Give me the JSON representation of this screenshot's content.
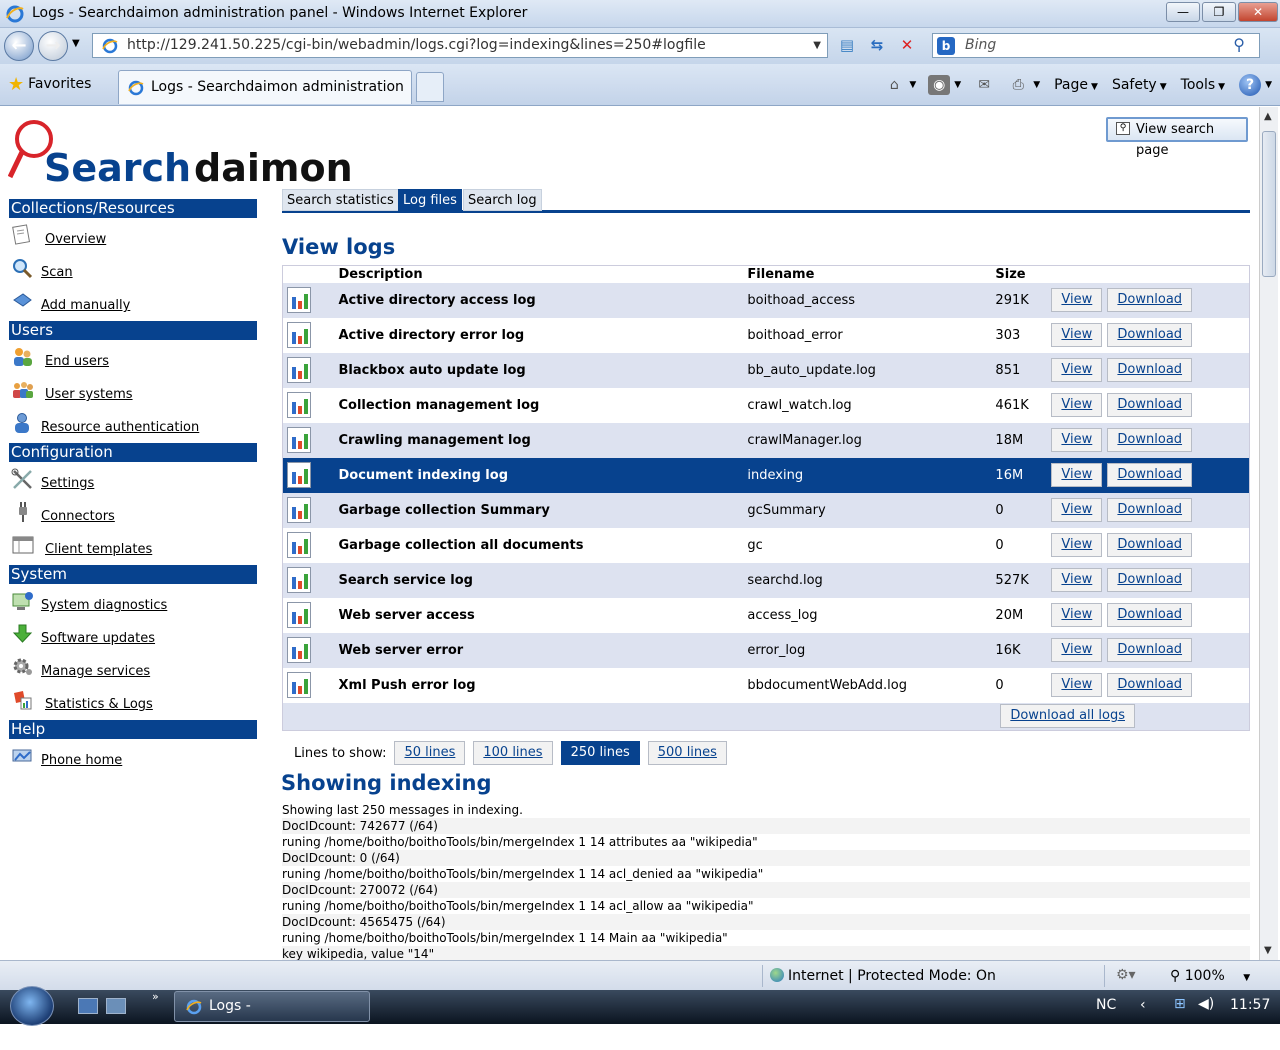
{
  "window": {
    "title": "Logs - Searchdaimon administration panel - Windows Internet Explorer",
    "min_glyph": "—",
    "max_glyph": "❐",
    "close_glyph": "✕"
  },
  "navbar": {
    "url": "http://129.241.50.225/cgi-bin/webadmin/logs.cgi?log=indexing&lines=250#logfile",
    "search_placeholder": "Bing",
    "back_glyph": "←",
    "forward_glyph": "→"
  },
  "tabbar": {
    "favorites_label": "Favorites",
    "tab_title": "Logs - Searchdaimon administration ...",
    "page_label": "Page",
    "safety_label": "Safety",
    "tools_label": "Tools"
  },
  "page": {
    "view_search_label": "View search page",
    "tabs": [
      "Search statistics",
      "Log files",
      "Search log"
    ],
    "active_tab": "Log files",
    "heading": "View logs",
    "table_headers": {
      "description": "Description",
      "filename": "Filename",
      "size": "Size"
    },
    "logs": [
      {
        "description": "Active directory access log",
        "filename": "boithoad_access",
        "size": "291K",
        "view": "View",
        "download": "Download"
      },
      {
        "description": "Active directory error log",
        "filename": "boithoad_error",
        "size": "303",
        "view": "View",
        "download": "Download"
      },
      {
        "description": "Blackbox auto update log",
        "filename": "bb_auto_update.log",
        "size": "851",
        "view": "View",
        "download": "Download"
      },
      {
        "description": "Collection management log",
        "filename": "crawl_watch.log",
        "size": "461K",
        "view": "View",
        "download": "Download"
      },
      {
        "description": "Crawling management log",
        "filename": "crawlManager.log",
        "size": "18M",
        "view": "View",
        "download": "Download"
      },
      {
        "description": "Document indexing log",
        "filename": "indexing",
        "size": "16M",
        "view": "View",
        "download": "Download"
      },
      {
        "description": "Garbage collection Summary",
        "filename": "gcSummary",
        "size": "0",
        "view": "View",
        "download": "Download"
      },
      {
        "description": "Garbage collection all documents",
        "filename": "gc",
        "size": "0",
        "view": "View",
        "download": "Download"
      },
      {
        "description": "Search service log",
        "filename": "searchd.log",
        "size": "527K",
        "view": "View",
        "download": "Download"
      },
      {
        "description": "Web server access",
        "filename": "access_log",
        "size": "20M",
        "view": "View",
        "download": "Download"
      },
      {
        "description": "Web server error",
        "filename": "error_log",
        "size": "16K",
        "view": "View",
        "download": "Download"
      },
      {
        "description": "Xml Push error log",
        "filename": "bbdocumentWebAdd.log",
        "size": "0",
        "view": "View",
        "download": "Download"
      }
    ],
    "selected_log": "Document indexing log",
    "download_all_label": "Download all logs",
    "lines_label": "Lines to show:",
    "line_options": [
      "50 lines",
      "100 lines",
      "250 lines",
      "500 lines"
    ],
    "active_lines": "250 lines",
    "showing_heading": "Showing indexing",
    "messages": [
      "Showing last 250 messages in indexing.",
      "DocIDcount: 742677 (/64)",
      "runing /home/boitho/boithoTools/bin/mergeIndex 1 14 attributes aa \"wikipedia\"",
      "DocIDcount: 0 (/64)",
      "runing /home/boitho/boithoTools/bin/mergeIndex 1 14 acl_denied aa \"wikipedia\"",
      "DocIDcount: 270072 (/64)",
      "runing /home/boitho/boithoTools/bin/mergeIndex 1 14 acl_allow aa \"wikipedia\"",
      "DocIDcount: 4565475 (/64)",
      "runing /home/boitho/boithoTools/bin/mergeIndex 1 14 Main aa \"wikipedia\"",
      "key wikipedia, value \"14\""
    ]
  },
  "sidebar": {
    "sections": [
      {
        "title": "Collections/Resources",
        "items": [
          {
            "label": "Overview",
            "icon": "overview-icon"
          },
          {
            "label": "Scan",
            "icon": "scan-icon"
          },
          {
            "label": "Add manually",
            "icon": "add-manually-icon"
          }
        ]
      },
      {
        "title": "Users",
        "items": [
          {
            "label": "End users",
            "icon": "end-users-icon"
          },
          {
            "label": "User systems",
            "icon": "user-systems-icon"
          },
          {
            "label": "Resource authentication",
            "icon": "resource-auth-icon"
          }
        ]
      },
      {
        "title": "Configuration",
        "items": [
          {
            "label": "Settings",
            "icon": "settings-icon"
          },
          {
            "label": "Connectors",
            "icon": "connectors-icon"
          },
          {
            "label": "Client templates",
            "icon": "client-templates-icon"
          }
        ]
      },
      {
        "title": "System",
        "items": [
          {
            "label": "System diagnostics",
            "icon": "diagnostics-icon"
          },
          {
            "label": "Software updates",
            "icon": "software-updates-icon"
          },
          {
            "label": "Manage services",
            "icon": "manage-services-icon"
          },
          {
            "label": "Statistics & Logs",
            "icon": "statistics-logs-icon"
          }
        ]
      },
      {
        "title": "Help",
        "items": [
          {
            "label": "Phone home",
            "icon": "phone-home-icon"
          }
        ]
      }
    ]
  },
  "statusbar": {
    "zone": "Internet | Protected Mode: On",
    "zoom": "100%"
  },
  "taskbar": {
    "task_label": "Logs - Searchdaimon...",
    "tray_text": "NC",
    "clock": "11:57"
  },
  "colors": {
    "brand_blue": "#07428e",
    "row_alt": "#dde2f0",
    "logo_red": "#d8242a"
  }
}
